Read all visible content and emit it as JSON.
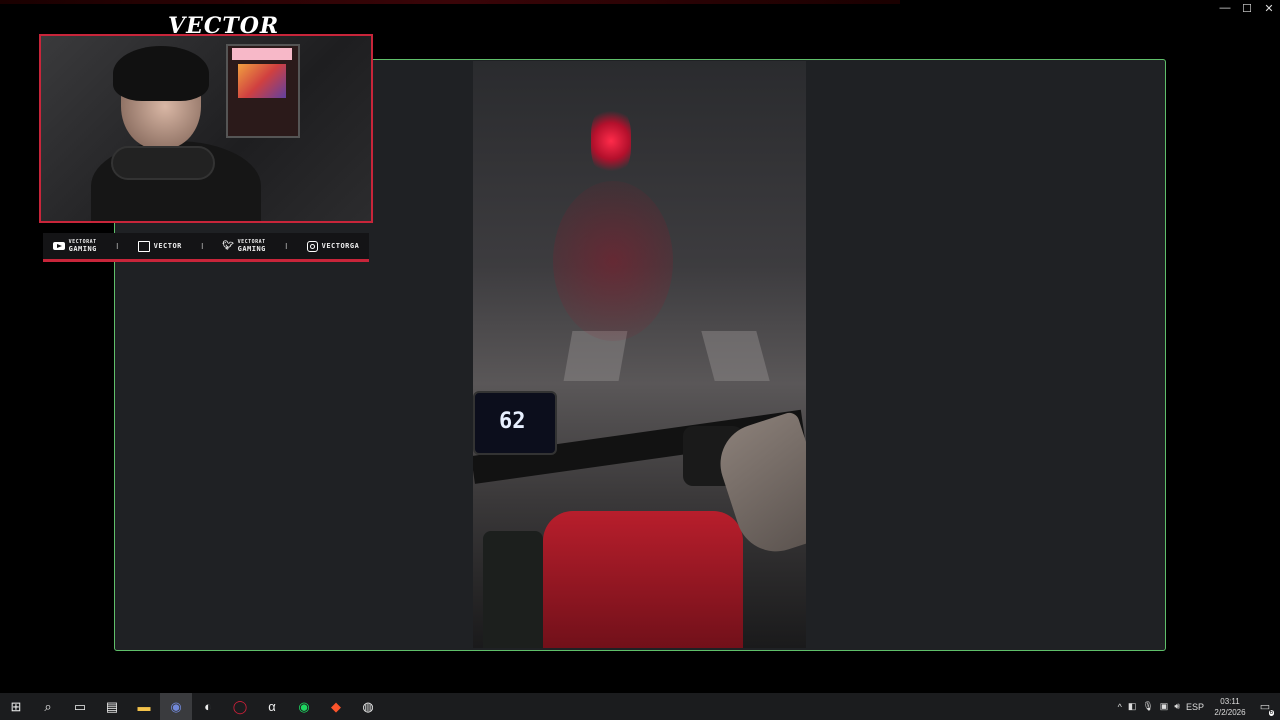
{
  "window": {
    "minimize": "—",
    "maximize": "☐",
    "close": "✕"
  },
  "overlay": {
    "channel_title": "VECTOR",
    "socials": [
      {
        "icon": "youtube-icon",
        "line1": "VECTORAT",
        "line2": "GAMING"
      },
      {
        "icon": "twitch-icon",
        "label": "VECTOR"
      },
      {
        "icon": "twitter-icon",
        "line1": "VECTORAT",
        "line2": "GAMING"
      },
      {
        "icon": "instagram-icon",
        "label": "VECTORGA"
      }
    ],
    "separator": "I"
  },
  "video": {
    "speed_readout": "62"
  },
  "taskbar": {
    "items": [
      {
        "name": "start-button",
        "glyph": "⊞"
      },
      {
        "name": "search-button",
        "glyph": "⌕"
      },
      {
        "name": "task-view-button",
        "glyph": "▭"
      },
      {
        "name": "app-explorer-alt",
        "glyph": "▤"
      },
      {
        "name": "file-explorer",
        "glyph": "▬"
      },
      {
        "name": "discord",
        "glyph": "◉"
      },
      {
        "name": "steam",
        "glyph": "◐"
      },
      {
        "name": "opera",
        "glyph": "◯"
      },
      {
        "name": "app-a",
        "glyph": "α"
      },
      {
        "name": "spotify",
        "glyph": "◉"
      },
      {
        "name": "brave",
        "glyph": "◆"
      },
      {
        "name": "obs",
        "glyph": "◍"
      }
    ],
    "tray": {
      "chevron": "^",
      "language": "ESP",
      "time": "03:11",
      "date": "2/2/2026",
      "notifications": "6"
    }
  },
  "colors": {
    "panel_border": "#5fbf6a",
    "overlay_accent": "#c8253a",
    "taskbar_bg": "#1b1c1e"
  }
}
